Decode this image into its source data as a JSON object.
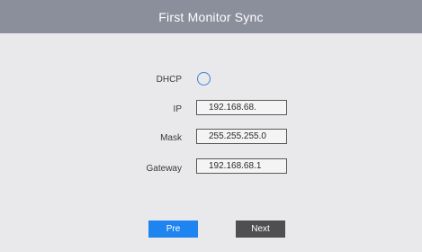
{
  "header": {
    "title": "First Monitor Sync"
  },
  "form": {
    "dhcp_label": "DHCP",
    "ip_label": "IP",
    "ip_value": "192.168.68.",
    "mask_label": "Mask",
    "mask_value": "255.255.255.0",
    "gateway_label": "Gateway",
    "gateway_value": "192.168.68.1"
  },
  "buttons": {
    "pre_label": "Pre",
    "next_label": "Next"
  },
  "colors": {
    "title_bar": "#8a8f9b",
    "background": "#e9e9eb",
    "pre_button": "#1e84f0",
    "next_button": "#4f4f51",
    "radio_ring": "#3d7fd6"
  }
}
